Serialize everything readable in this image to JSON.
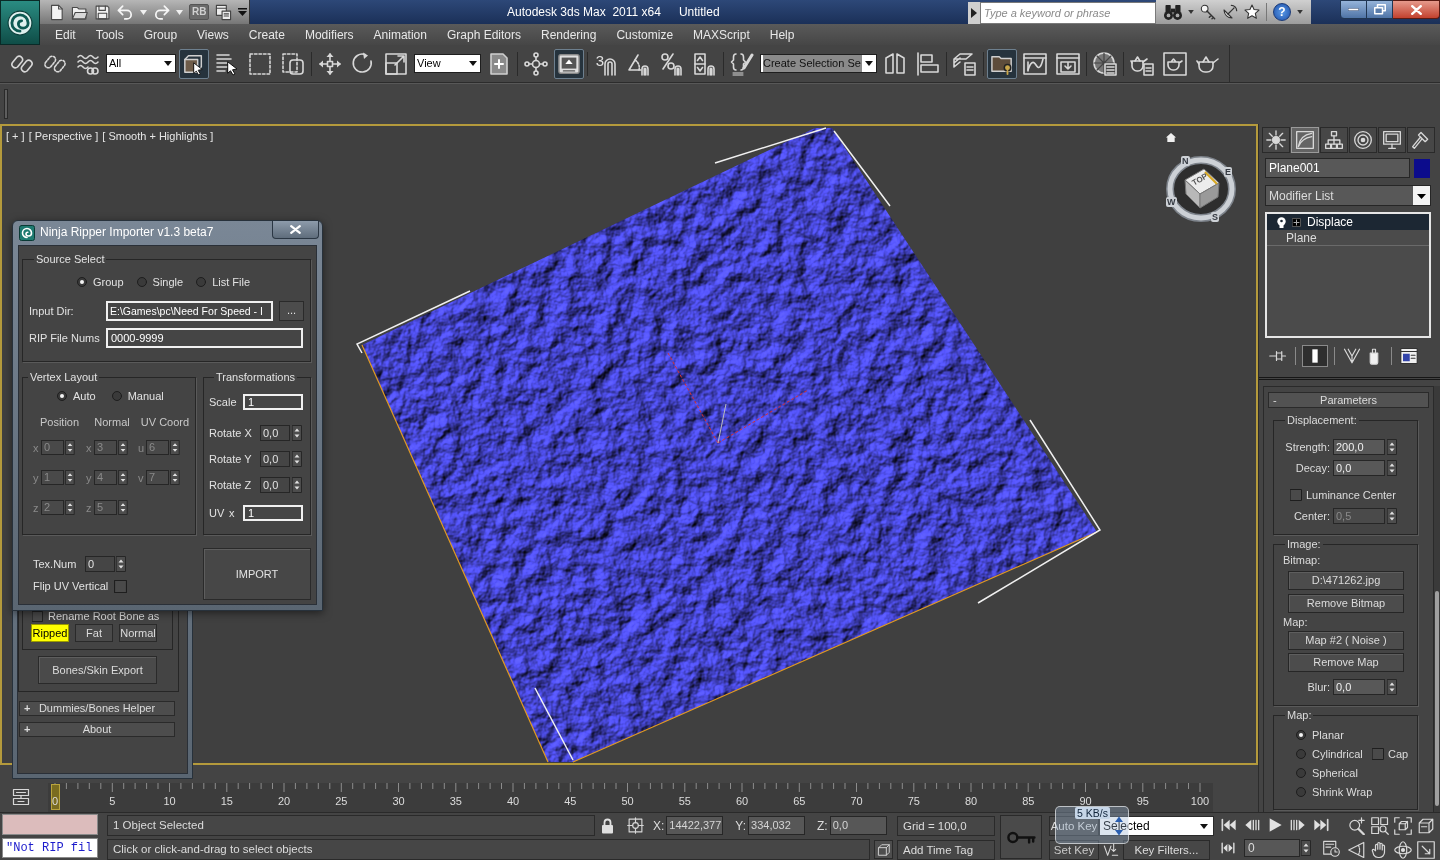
{
  "title_bar": {
    "app_title": "Autodesk 3ds Max  2011 x64",
    "document_title": "Untitled",
    "quick_access_label": "RB",
    "search": {
      "placeholder": "Type a keyword or phrase"
    },
    "help_label": "?"
  },
  "menu_bar": {
    "items": [
      "Edit",
      "Tools",
      "Group",
      "Views",
      "Create",
      "Modifiers",
      "Animation",
      "Graph Editors",
      "Rendering",
      "Customize",
      "MAXScript",
      "Help"
    ]
  },
  "main_toolbar": {
    "buttons": [
      {
        "pressed": false
      },
      {
        "pressed": false
      },
      {
        "pressed": false
      },
      {
        "pressed": true
      },
      {
        "pressed": false
      },
      {
        "pressed": false
      },
      {
        "pressed": false
      },
      {
        "pressed": false
      },
      {
        "pressed": false
      },
      {
        "pressed": false
      },
      {
        "pressed": false
      },
      {
        "pressed": false
      },
      {
        "pressed": true
      },
      {
        "pressed": false
      },
      {
        "pressed": false
      },
      {
        "pressed": false
      },
      {
        "pressed": false
      },
      {
        "pressed": false
      },
      {
        "pressed": false
      },
      {
        "pressed": false
      },
      {
        "pressed": false
      },
      {
        "pressed": true
      },
      {
        "pressed": false
      },
      {
        "pressed": false
      },
      {
        "pressed": false
      },
      {
        "pressed": false
      },
      {
        "pressed": false
      },
      {
        "pressed": false
      }
    ],
    "selection_filter": "All",
    "reference_coordinate_system": "View",
    "snap_label": "3",
    "named_selection_set": "Create Selection Se"
  },
  "viewport": {
    "labels": [
      "[ + ]",
      "[ Perspective ]",
      "[ Smooth + Highlights ]"
    ],
    "viewcube": {
      "face_label": "TOP",
      "compass": [
        "N",
        "E",
        "S",
        "W"
      ]
    }
  },
  "ninja_dialog": {
    "title": "Ninja Ripper Importer v1.3 beta7",
    "source_select": {
      "title": "Source Select",
      "options": [
        {
          "label": "Group",
          "selected": true
        },
        {
          "label": "Single",
          "selected": false
        },
        {
          "label": "List File",
          "selected": false
        }
      ],
      "input_dir": {
        "label": "Input Dir:",
        "value": "E:\\Games\\pc\\Need For Speed - I",
        "browse_button": "..."
      },
      "rip_file_nums": {
        "label": "RIP File Nums",
        "value": "0000-9999"
      }
    },
    "vertex_layout": {
      "title": "Vertex Layout",
      "modes": [
        {
          "label": "Auto",
          "selected": true
        },
        {
          "label": "Manual",
          "selected": false
        }
      ],
      "disabled": true,
      "columns": [
        {
          "header": "Position",
          "fields": [
            {
              "axis": "x",
              "value": "0"
            },
            {
              "axis": "y",
              "value": "1"
            },
            {
              "axis": "z",
              "value": "2"
            }
          ]
        },
        {
          "header": "Normal",
          "fields": [
            {
              "axis": "x",
              "value": "3"
            },
            {
              "axis": "y",
              "value": "4"
            },
            {
              "axis": "z",
              "value": "5"
            }
          ]
        },
        {
          "header": "UV Coord",
          "fields": [
            {
              "axis": "u",
              "value": "6"
            },
            {
              "axis": "v",
              "value": "7"
            }
          ]
        }
      ]
    },
    "transformations": {
      "title": "Transformations",
      "scale": {
        "label": "Scale",
        "value": "1"
      },
      "rotations": [
        {
          "label": "Rotate X",
          "value": "0,0"
        },
        {
          "label": "Rotate Y",
          "value": "0,0"
        },
        {
          "label": "Rotate Z",
          "value": "0,0"
        }
      ],
      "uv_scale": {
        "label": "UV",
        "axis": "x",
        "value": "1"
      }
    },
    "tex_num": {
      "label": "Tex.Num",
      "value": "0"
    },
    "flip_uv_vertical": {
      "label": "Flip UV Vertical",
      "checked": false
    },
    "import_button": "IMPORT"
  },
  "bones_panel": {
    "rename_root_bone": {
      "label": "Rename Root Bone as",
      "checked": false
    },
    "root_bone_names": [
      {
        "label": "Ripped",
        "selected": true
      },
      {
        "label": "Fat",
        "selected": false
      },
      {
        "label": "Normal",
        "selected": false
      }
    ],
    "export_button": "Bones/Skin Export",
    "rollouts": [
      {
        "sign": "+",
        "title": "Dummies/Bones Helper"
      },
      {
        "sign": "+",
        "title": "About"
      }
    ]
  },
  "command_panel": {
    "tabs": [
      {
        "selected": false
      },
      {
        "selected": true
      },
      {
        "selected": false
      },
      {
        "selected": false
      },
      {
        "selected": false
      },
      {
        "selected": false
      }
    ],
    "object_name": "Plane001",
    "modifier_list": "Modifier List",
    "stack": [
      {
        "kind": "modifier",
        "label": "Displace",
        "selected": true
      },
      {
        "kind": "base_object",
        "label": "Plane",
        "selected": false
      }
    ],
    "stack_tools": [
      {
        "pressed": false
      },
      {
        "pressed": true
      },
      {
        "pressed": false
      },
      {
        "pressed": false
      },
      {
        "pressed": false
      }
    ],
    "parameters": {
      "sign": "-",
      "title": "Parameters",
      "displacement": {
        "title": "Displacement:",
        "strength": {
          "label": "Strength:",
          "value": "200,0"
        },
        "decay": {
          "label": "Decay:",
          "value": "0,0"
        },
        "luminance_center": {
          "label": "Luminance Center",
          "checked": false
        },
        "center": {
          "label": "Center:",
          "value": "0,5",
          "disabled": true
        }
      },
      "image": {
        "title": "Image:",
        "bitmap_label": "Bitmap:",
        "bitmap_button": "D:\\471262.jpg",
        "remove_bitmap_button": "Remove Bitmap",
        "map_label": "Map:",
        "map_button": "Map #2 ( Noise )",
        "remove_map_button": "Remove Map",
        "blur": {
          "label": "Blur:",
          "value": "0,0"
        }
      },
      "mapping": {
        "title": "Map:",
        "types": [
          {
            "label": "Planar",
            "selected": true
          },
          {
            "label": "Cylindrical",
            "selected": false,
            "cap": {
              "label": "Cap",
              "checked": false
            }
          },
          {
            "label": "Spherical",
            "selected": false
          },
          {
            "label": "Shrink Wrap",
            "selected": false
          }
        ]
      }
    }
  },
  "timeline": {
    "frame_labels": [
      "0",
      "5",
      "10",
      "15",
      "20",
      "25",
      "30",
      "35",
      "40",
      "45",
      "50",
      "55",
      "60",
      "65",
      "70",
      "75",
      "80",
      "85",
      "90",
      "95",
      "100"
    ],
    "time_slider": {
      "level": 0
    }
  },
  "status_bar": {
    "listener_output": "\"Not RIP fil",
    "selection_status": "1 Object Selected",
    "prompt": "Click or click-and-drag to select objects",
    "coordinates": [
      {
        "label": "X:",
        "value": "14422,377"
      },
      {
        "label": "Y:",
        "value": "334,032"
      },
      {
        "label": "Z:",
        "value": "0,0"
      }
    ],
    "grid": "Grid = 100,0",
    "time_tag": "Add Time Tag",
    "auto_key": {
      "label": "Auto Key",
      "on": false
    },
    "key_mode": "Selected",
    "set_key": "Set Key",
    "key_filters": "Key Filters...",
    "current_frame": "0",
    "network_meter": "5 KB/s"
  }
}
